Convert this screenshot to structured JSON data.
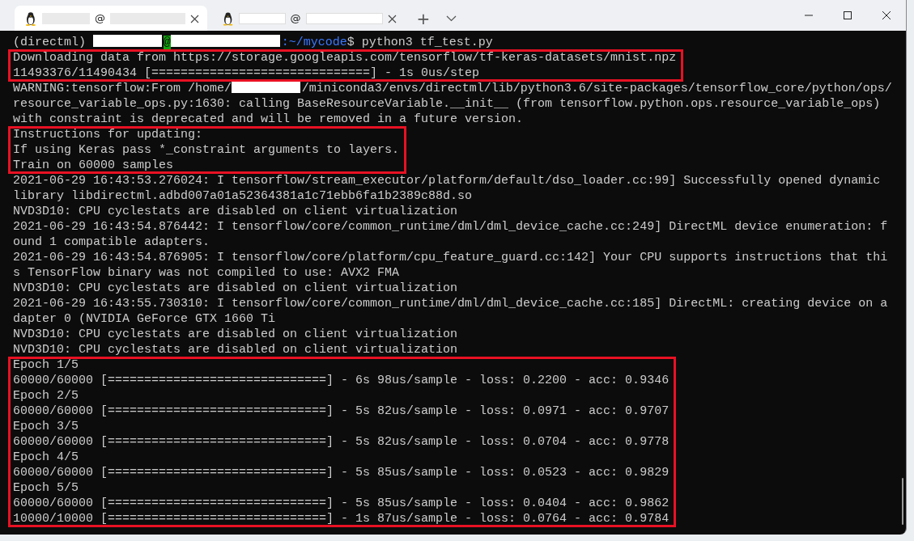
{
  "tabs": [
    {
      "label": "@",
      "selected": true
    },
    {
      "label": "@",
      "selected": false
    }
  ],
  "new_tab": "+",
  "terminal": {
    "blocks": [
      {
        "highlighted": false,
        "lines": [
          [
            {
              "kind": "text",
              "text": "(directml) "
            },
            {
              "kind": "user"
            },
            {
              "kind": "at",
              "text": "@"
            },
            {
              "kind": "host"
            },
            {
              "kind": "path",
              "text": ":~/mycode"
            },
            {
              "kind": "text",
              "text": "$ python3 tf_test.py"
            }
          ]
        ]
      },
      {
        "highlighted": true,
        "lines": [
          [
            {
              "kind": "text",
              "text": "Downloading data from https://storage.googleapis.com/tensorflow/tf-keras-datasets/mnist.npz"
            }
          ],
          [
            {
              "kind": "text",
              "text": "11493376/11490434 [==============================] - 1s 0us/step"
            }
          ]
        ]
      },
      {
        "highlighted": false,
        "lines": [
          [
            {
              "kind": "text",
              "text": "WARNING:tensorflow:From /home/"
            },
            {
              "kind": "user"
            },
            {
              "kind": "text",
              "text": "/miniconda3/envs/directml/lib/python3.6/site-packages/tensorflow_core/python/ops/"
            }
          ],
          [
            {
              "kind": "text",
              "text": "resource_variable_ops.py:1630: calling BaseResourceVariable.__init__ (from tensorflow.python.ops.resource_variable_ops)"
            }
          ],
          [
            {
              "kind": "text",
              "text": "with constraint is deprecated and will be removed in a future version."
            }
          ]
        ]
      },
      {
        "highlighted": true,
        "lines": [
          [
            {
              "kind": "text",
              "text": "Instructions for updating:"
            }
          ],
          [
            {
              "kind": "text",
              "text": "If using Keras pass *_constraint arguments to layers."
            }
          ],
          [
            {
              "kind": "text",
              "text": "Train on 60000 samples"
            }
          ]
        ]
      },
      {
        "highlighted": false,
        "lines": [
          [
            {
              "kind": "text",
              "text": "2021-06-29 16:43:53.276024: I tensorflow/stream_executor/platform/default/dso_loader.cc:99] Successfully opened dynamic"
            }
          ],
          [
            {
              "kind": "text",
              "text": "library libdirectml.adbd007a01a52364381a1c71ebb6fa1b2389c88d.so"
            }
          ],
          [
            {
              "kind": "text",
              "text": "NVD3D10: CPU cyclestats are disabled on client virtualization"
            }
          ],
          [
            {
              "kind": "text",
              "text": "2021-06-29 16:43:54.876442: I tensorflow/core/common_runtime/dml/dml_device_cache.cc:249] DirectML device enumeration: f"
            }
          ],
          [
            {
              "kind": "text",
              "text": "ound 1 compatible adapters."
            }
          ],
          [
            {
              "kind": "text",
              "text": "2021-06-29 16:43:54.876905: I tensorflow/core/platform/cpu_feature_guard.cc:142] Your CPU supports instructions that thi"
            }
          ],
          [
            {
              "kind": "text",
              "text": "s TensorFlow binary was not compiled to use: AVX2 FMA"
            }
          ],
          [
            {
              "kind": "text",
              "text": "NVD3D10: CPU cyclestats are disabled on client virtualization"
            }
          ],
          [
            {
              "kind": "text",
              "text": "2021-06-29 16:43:55.730310: I tensorflow/core/common_runtime/dml/dml_device_cache.cc:185] DirectML: creating device on a"
            }
          ],
          [
            {
              "kind": "text",
              "text": "dapter 0 (NVIDIA GeForce GTX 1660 Ti"
            }
          ],
          [
            {
              "kind": "text",
              "text": "NVD3D10: CPU cyclestats are disabled on client virtualization"
            }
          ],
          [
            {
              "kind": "text",
              "text": "NVD3D10: CPU cyclestats are disabled on client virtualization"
            }
          ]
        ]
      },
      {
        "highlighted": true,
        "lines": [
          [
            {
              "kind": "text",
              "text": "Epoch 1/5"
            }
          ],
          [
            {
              "kind": "text",
              "text": "60000/60000 [==============================] - 6s 98us/sample - loss: 0.2200 - acc: 0.9346"
            }
          ],
          [
            {
              "kind": "text",
              "text": "Epoch 2/5"
            }
          ],
          [
            {
              "kind": "text",
              "text": "60000/60000 [==============================] - 5s 82us/sample - loss: 0.0971 - acc: 0.9707"
            }
          ],
          [
            {
              "kind": "text",
              "text": "Epoch 3/5"
            }
          ],
          [
            {
              "kind": "text",
              "text": "60000/60000 [==============================] - 5s 82us/sample - loss: 0.0704 - acc: 0.9778"
            }
          ],
          [
            {
              "kind": "text",
              "text": "Epoch 4/5"
            }
          ],
          [
            {
              "kind": "text",
              "text": "60000/60000 [==============================] - 5s 85us/sample - loss: 0.0523 - acc: 0.9829"
            }
          ],
          [
            {
              "kind": "text",
              "text": "Epoch 5/5"
            }
          ],
          [
            {
              "kind": "text",
              "text": "60000/60000 [==============================] - 5s 85us/sample - loss: 0.0404 - acc: 0.9862"
            }
          ],
          [
            {
              "kind": "text",
              "text": "10000/10000 [==============================] - 1s 87us/sample - loss: 0.0764 - acc: 0.9784"
            }
          ]
        ]
      }
    ]
  }
}
